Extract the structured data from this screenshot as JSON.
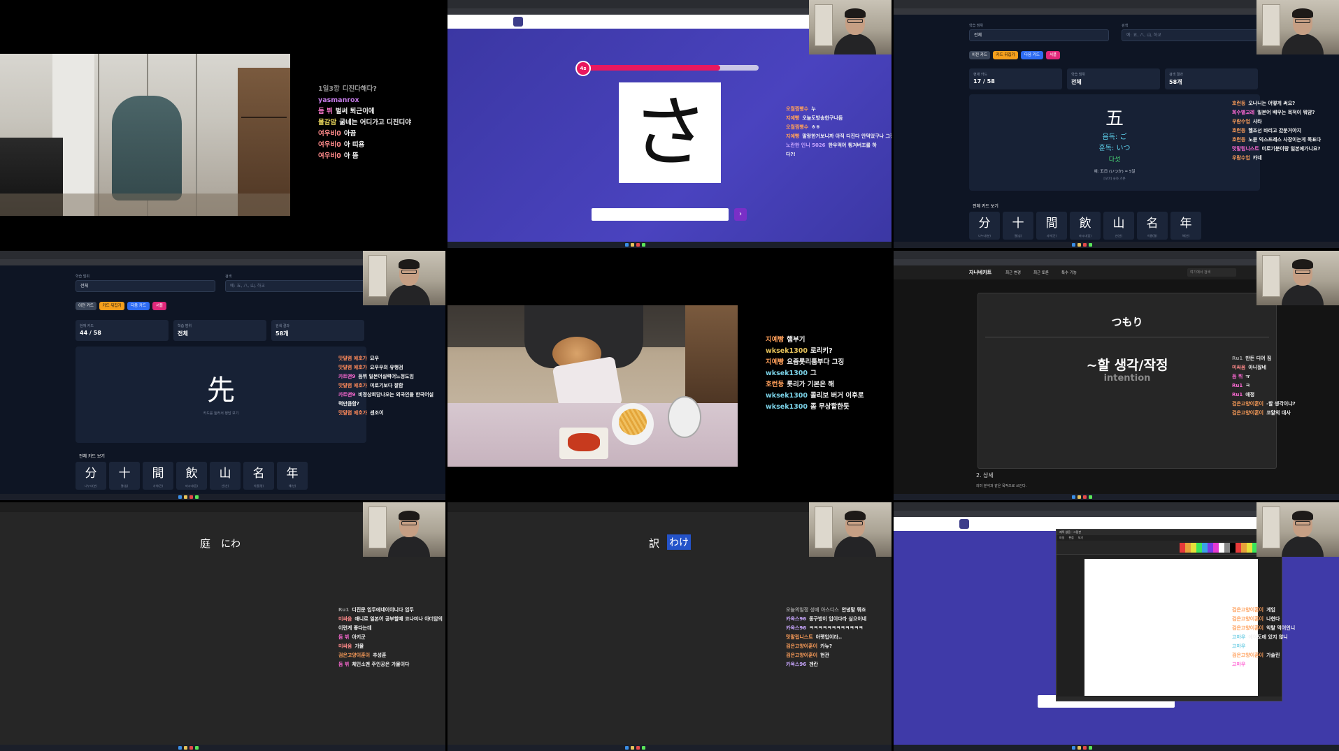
{
  "cell1": {
    "chat": [
      {
        "name": "1일3깡",
        "text": "디진다해다?",
        "color": "#8a8a8a",
        "textcolor": "#9a9a9a"
      },
      {
        "name": "yasmanrox",
        "text": "",
        "color": "#c37ae6"
      },
      {
        "name": "듬 뷔",
        "text": "벌써 퇴근이에",
        "color": "#ff7ad1"
      },
      {
        "name": "물감맘",
        "text": "굶네는 어디가고 디진디야",
        "color": "#e6d35b"
      },
      {
        "name": "여우비0",
        "text": "아끔",
        "color": "#ff8a8a"
      },
      {
        "name": "여우비0",
        "text": "아 띠용",
        "color": "#ff8a8a"
      },
      {
        "name": "여우비0",
        "text": "아 뜸",
        "color": "#ff8a8a"
      }
    ]
  },
  "cell2": {
    "kana": "さ",
    "timer": "4s",
    "progress": 0.78,
    "submit_icon": "chevron-right-icon",
    "chat": [
      {
        "name": "오월찜빵수",
        "text": "누",
        "color": "#ff9f5a"
      },
      {
        "name": "지예빵",
        "text": "오늘도방송한구나듬",
        "color": "#ff9f5a"
      },
      {
        "name": "오월찜빵수",
        "text": "ㅎㅎ",
        "color": "#ff9f5a"
      },
      {
        "name": "지예빵",
        "text": "말랑한거보니까 아직 디진다 안먹었구나 그징",
        "color": "#ff9f5a"
      },
      {
        "name": "노란한 인니 5026",
        "text": "한우먹어 튕겨버조를 하",
        "color": "#c9a7ff"
      },
      {
        "name": "",
        "text": "다?!",
        "color": "#ffffff"
      }
    ]
  },
  "cell3": {
    "filter_label": "학습 범위",
    "filter_value": "전체",
    "search_label": "검색",
    "search_placeholder": "예: 五, 八, 山, 하교",
    "buttons": [
      "이전 카드",
      "카드 뒤집기",
      "다음 카드",
      "셔플"
    ],
    "stats": [
      {
        "label": "현재 카드",
        "value": "17 / 58"
      },
      {
        "label": "학습 범위",
        "value": "전체"
      },
      {
        "label": "검색 결과",
        "value": "58개"
      }
    ],
    "kanji": "五",
    "on_reading": "음독: ご",
    "kun_reading": "훈독: いつ",
    "meaning": "다섯",
    "example": "예: 五日 (いつか) = 5일",
    "example_note": "[오마] 숫자 기본",
    "list_title": "전체 카드 보기",
    "list": [
      {
        "k": "分",
        "sub": "나누다(분)"
      },
      {
        "k": "十",
        "sub": "열(십)"
      },
      {
        "k": "間",
        "sub": "사이(간)"
      },
      {
        "k": "飲",
        "sub": "마시다(음)"
      },
      {
        "k": "山",
        "sub": "산(산)"
      },
      {
        "k": "名",
        "sub": "이름(명)"
      },
      {
        "k": "年",
        "sub": "해(년)"
      }
    ],
    "chat": [
      {
        "name": "호런등",
        "text": "오나니는 어떻게 써요?",
        "color": "#ff9f5a"
      },
      {
        "name": "희수별교레",
        "text": "일본어 배우는 목적이 뭐얌?",
        "color": "#ff6ad5"
      },
      {
        "name": "우람수업",
        "text": "사타",
        "color": "#ff9f5a"
      },
      {
        "name": "호런등",
        "text": "헬조선 바리고 갔분거야지",
        "color": "#ff9f5a"
      },
      {
        "name": "호런등",
        "text": "노뮨 익스프레스 사장이는게 목표다",
        "color": "#ff9f5a"
      },
      {
        "name": "맛말립니스트",
        "text": "미로기분이랑 일본에가니요?",
        "color": "#ff6ad5"
      },
      {
        "name": "우람수업",
        "text": "카네",
        "color": "#ff9f5a"
      }
    ]
  },
  "cell4": {
    "filter_label": "학습 범위",
    "filter_value": "전체",
    "search_label": "검색",
    "search_placeholder": "예: 五, 八, 山, 하교",
    "buttons": [
      "이전 카드",
      "카드 뒤집기",
      "다음 카드",
      "셔플"
    ],
    "stats": [
      {
        "label": "현재 카드",
        "value": "44 / 58"
      },
      {
        "label": "학습 범위",
        "value": "전체"
      },
      {
        "label": "검색 결과",
        "value": "58개"
      }
    ],
    "kanji": "先",
    "hint": "카드를 눌러서 정답 보기",
    "list_title": "전체 카드 보기",
    "list": [
      {
        "k": "分",
        "sub": "나누다(분)"
      },
      {
        "k": "十",
        "sub": "열(십)"
      },
      {
        "k": "間",
        "sub": "사이(간)"
      },
      {
        "k": "飲",
        "sub": "마시다(음)"
      },
      {
        "k": "山",
        "sub": "산(산)"
      },
      {
        "k": "名",
        "sub": "이름(명)"
      },
      {
        "k": "年",
        "sub": "해(년)"
      }
    ],
    "chat": [
      {
        "name": "맛말렴 애호가",
        "text": "묘우",
        "color": "#ff8a5a"
      },
      {
        "name": "맛말렴 애호가",
        "text": "요우우의 유행검",
        "color": "#ff8a5a"
      },
      {
        "name": "카트맨9",
        "text": "듬뷔 일본어실력어느정도임",
        "color": "#ff6ad5"
      },
      {
        "name": "맛말렴 애호가",
        "text": "미로기보다 잘함",
        "color": "#ff8a5a"
      },
      {
        "name": "카트맨9",
        "text": "비정상회담나오는 외국인들 한국어실",
        "color": "#ff6ad5"
      },
      {
        "name": "",
        "text": "력만큼함?",
        "color": "#ffffff"
      },
      {
        "name": "맛말렴 애호가",
        "text": "센조이",
        "color": "#ff8a5a"
      }
    ]
  },
  "cell5": {
    "chat": [
      {
        "name": "지예빵",
        "text": "햄부기",
        "color": "#ff9f5a"
      },
      {
        "name": "wksek1300",
        "text": "로리키?",
        "color": "#e6c35b"
      },
      {
        "name": "지예빵",
        "text": "요즘롯리툼부다 그징",
        "color": "#ff9f5a"
      },
      {
        "name": "wksek1300",
        "text": "그",
        "color": "#7ad1e6"
      },
      {
        "name": "호런등",
        "text": "롯리가 기본은 해",
        "color": "#ff9f5a"
      },
      {
        "name": "wksek1300",
        "text": "콜리보 버거 이후로",
        "color": "#7ad1e6"
      },
      {
        "name": "wksek1300",
        "text": "좀 무상할한듯",
        "color": "#7ad1e6"
      }
    ]
  },
  "cell6": {
    "site_title": "자나네카트",
    "nav": [
      "최근 변경",
      "최근 토론",
      "특수 기능"
    ],
    "search_placeholder": "여기에서 검색",
    "word": "つもり",
    "translation": "~할 생각/작정",
    "english": "intention",
    "section": "2. 상세",
    "bottom_note": "의미 분석과 같은 목적으로 쓰인다.",
    "chat": [
      {
        "name": "Ru1",
        "text": "만든 디어 짐",
        "color": "#9a9a9a"
      },
      {
        "name": "미싸움",
        "text": "아니잖네",
        "color": "#ff8a8a"
      },
      {
        "name": "듬 뷔",
        "text": "ㅠ",
        "color": "#ff6ad5"
      },
      {
        "name": "Ru1",
        "text": "ㅋ",
        "color": "#ff6ad5"
      },
      {
        "name": "Ru1",
        "text": "애정",
        "color": "#ff6ad5"
      },
      {
        "name": "검은고양이훈이",
        "text": "-할 생각이냐?",
        "color": "#ff9f5a"
      },
      {
        "name": "검은고양이훈이",
        "text": "코얄의 대사",
        "color": "#ff9f5a"
      }
    ]
  },
  "cell7": {
    "kanji": "庭",
    "kana": "にわ",
    "chat": [
      {
        "name": "Ru1",
        "text": "디진문 입두에네이야니다 입두",
        "color": "#9a9a9a"
      },
      {
        "name": "미싸움",
        "text": "애니로 일본어 공부할때 코나미나 아더암의",
        "color": "#ff8a8a"
      },
      {
        "name": "",
        "text": "이런게 좋다는데",
        "color": "#ffffff"
      },
      {
        "name": "듬 뷔",
        "text": "아키군",
        "color": "#ff6ad5"
      },
      {
        "name": "미싸움",
        "text": "가물",
        "color": "#ff8a8a"
      },
      {
        "name": "검은고양이훈이",
        "text": "추성훈",
        "color": "#ff9f5a"
      },
      {
        "name": "듬 뷔",
        "text": "체인소맨 주인공은 가물이다",
        "color": "#ff6ad5"
      }
    ]
  },
  "cell8": {
    "kanji": "訳",
    "kana": "わけ",
    "chat": [
      {
        "name": "오늘의일정 성에 아스디스",
        "text": "안녕말 뭐죠",
        "color": "#9a9a9a"
      },
      {
        "name": "카옥스96",
        "text": "동구방이 입이다라 싶으이네",
        "color": "#c9a7ff"
      },
      {
        "name": "카옥스96",
        "text": "ㅋㅋㅋㅋㅋㅋㅋㅋㅋㅋㅋㅋ",
        "color": "#c9a7ff"
      },
      {
        "name": "맛말립니스트",
        "text": "아랫입이라..",
        "color": "#ff9f5a"
      },
      {
        "name": "검은고양이훈이",
        "text": "카뉴?",
        "color": "#ff9f5a"
      },
      {
        "name": "검은고양이훈이",
        "text": "현관",
        "color": "#ff9f5a"
      },
      {
        "name": "카옥스96",
        "text": "겐칸",
        "color": "#c9a7ff"
      }
    ]
  },
  "cell9": {
    "paint_title": "제목 없음 - 그림판",
    "paint_menu": [
      "파일",
      "편집",
      "보기"
    ],
    "chat": [
      {
        "name": "검은고양이훈이",
        "text": "게임",
        "color": "#ff9f5a"
      },
      {
        "name": "검은고양이훈이",
        "text": "나현다",
        "color": "#ff9f5a"
      },
      {
        "name": "검은고양이훈이",
        "text": "악랄 먹어인니",
        "color": "#ff9f5a"
      },
      {
        "name": "고마우",
        "text": "에이도에 있지 않니",
        "color": "#7ad1e6"
      },
      {
        "name": "고마우",
        "text": "",
        "color": "#7ad1e6"
      },
      {
        "name": "검은고양이훈이",
        "text": "가솔린",
        "color": "#ff9f5a"
      },
      {
        "name": "고마우",
        "text": "",
        "color": "#ff6ad5"
      }
    ]
  }
}
